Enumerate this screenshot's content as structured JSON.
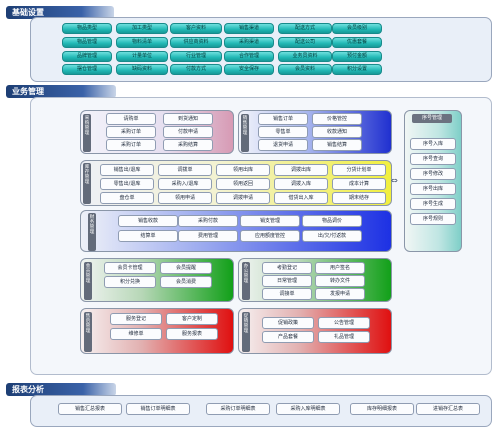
{
  "sections": {
    "basic": {
      "title": "基础设置"
    },
    "business": {
      "title": "业务管理"
    },
    "reports": {
      "title": "报表分析"
    }
  },
  "basic_buttons": [
    [
      "物品类型",
      "加工类型",
      "客户资料",
      "销售渠道",
      "配送方式",
      "会员级别"
    ],
    [
      "物品管理",
      "物料清单",
      "供应商资料",
      "采购渠道",
      "配送公司",
      "优惠套餐"
    ],
    [
      "品牌管理",
      "计量单位",
      "行业管理",
      "合作管理",
      "业务员资料",
      "预付金额"
    ],
    [
      "摆仓管理",
      "缺码资料",
      "付款方式",
      "安全保存",
      "会员资料",
      "积分设置"
    ]
  ],
  "groups": {
    "purchase": {
      "label": "采购管理",
      "buttons": [
        "请购单",
        "到货通知",
        "采购订单",
        "付款申请",
        "采购订单",
        "采购结算"
      ]
    },
    "sales": {
      "label": "销售管理",
      "buttons": [
        "销售订单",
        "价格管控",
        "零售单",
        "收款通知",
        "退货申请",
        "销售结算"
      ]
    },
    "inventory": {
      "label": "库存管理",
      "buttons": [
        "销售出/退库",
        "调拨单",
        "领用出库",
        "调拨出库",
        "分货计划单",
        "零售出/退库",
        "采购入/退库",
        "领用返回",
        "调拨入库",
        "成本计算",
        "盘仓单",
        "领用申请",
        "调拨申请",
        "借货出入库",
        "期末结存"
      ]
    },
    "finance": {
      "label": "财务管理",
      "buttons": [
        "销售收款",
        "采购付款",
        "销支管理",
        "物品调价",
        "结算单",
        "费用管理",
        "应用额度管控",
        "出/欠/付返款"
      ]
    },
    "member": {
      "label": "会员管理",
      "buttons": [
        "会员卡管理",
        "会员提醒",
        "积分兑换",
        "会员消费"
      ]
    },
    "office": {
      "label": "办公管理",
      "buttons": [
        "考勤登记",
        "用户签名",
        "日常管理",
        "转办文件",
        "调接单",
        "发报申请"
      ]
    },
    "service": {
      "label": "售后管理",
      "buttons": [
        "服务登记",
        "客户定制",
        "维修单",
        "服务报表"
      ]
    },
    "promo": {
      "label": "促销管理",
      "buttons": [
        "促销政策",
        "公告管理",
        "产品套餐",
        "礼品管理"
      ]
    }
  },
  "serial": {
    "label": "序号管理",
    "buttons": [
      "序号入库",
      "序号查询",
      "序号修改",
      "序号出库",
      "序号生成",
      "序号规则"
    ]
  },
  "report_buttons": [
    "销售汇总报表",
    "销售订单明细表",
    "采购订单明细表",
    "采购入库明细表",
    "库存明细报表",
    "进销存汇总表"
  ],
  "icons": {
    "double_arrow": "⇔"
  }
}
